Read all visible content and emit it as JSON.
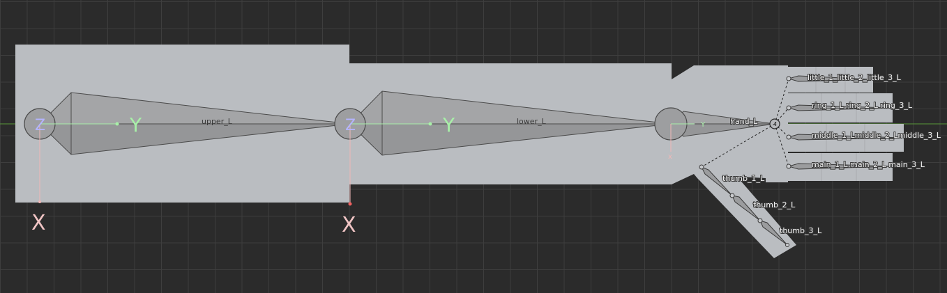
{
  "viewport": {
    "grid_color": "#3e3e3e",
    "background": "#2b2b2b",
    "mesh_color": "#babdc1",
    "bone_color": "#9b9c9e",
    "axis_y_color": "#a8f0a8",
    "axis_x_color": "#f0b8b8"
  },
  "bones": {
    "upper": "upper_L",
    "lower": "lower_L",
    "hand": "hand_L",
    "little": "little_1_little_2_little_3_L",
    "ring": "ring_1_L ring_2_L ring_3_L",
    "middle": "middle_1_Lmiddle_2_Lmiddle_3_L",
    "main": "main_1_L main_2_L main_3_L",
    "thumb1": "thumb_1_L",
    "thumb2": "thumb_2_L",
    "thumb3": "thumb_3_L"
  },
  "axes": {
    "y": "Y",
    "x": "X",
    "z": "Z",
    "y_small": "Y",
    "x_small": "x"
  }
}
